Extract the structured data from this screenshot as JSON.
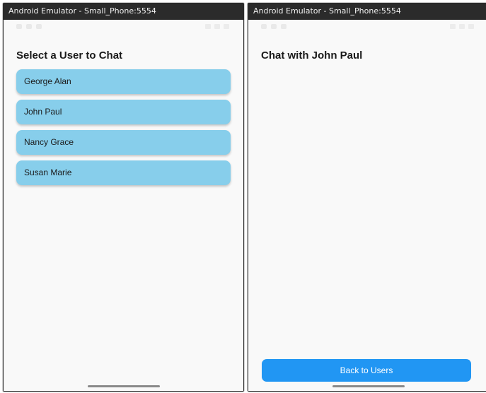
{
  "left_emulator": {
    "window_title": "Android Emulator - Small_Phone:5554",
    "screen_title": "Select a User to Chat",
    "users": [
      {
        "label": "George Alan"
      },
      {
        "label": "John Paul"
      },
      {
        "label": "Nancy Grace"
      },
      {
        "label": "Susan Marie"
      }
    ]
  },
  "right_emulator": {
    "window_title": "Android Emulator - Small_Phone:5554",
    "screen_title": "Chat with John Paul",
    "back_button_label": "Back to Users"
  },
  "icons": {
    "status_bar": [
      "status-time-icon",
      "notification-icon",
      "wifi-icon",
      "signal-icon",
      "battery-icon"
    ],
    "navigation": [
      "home-indicator-icon"
    ]
  },
  "colors": {
    "user_item_background": "#87ceeb",
    "back_button_background": "#2196f3",
    "screen_background": "#f9f9f9",
    "titlebar_background": "#2b2b2b"
  }
}
